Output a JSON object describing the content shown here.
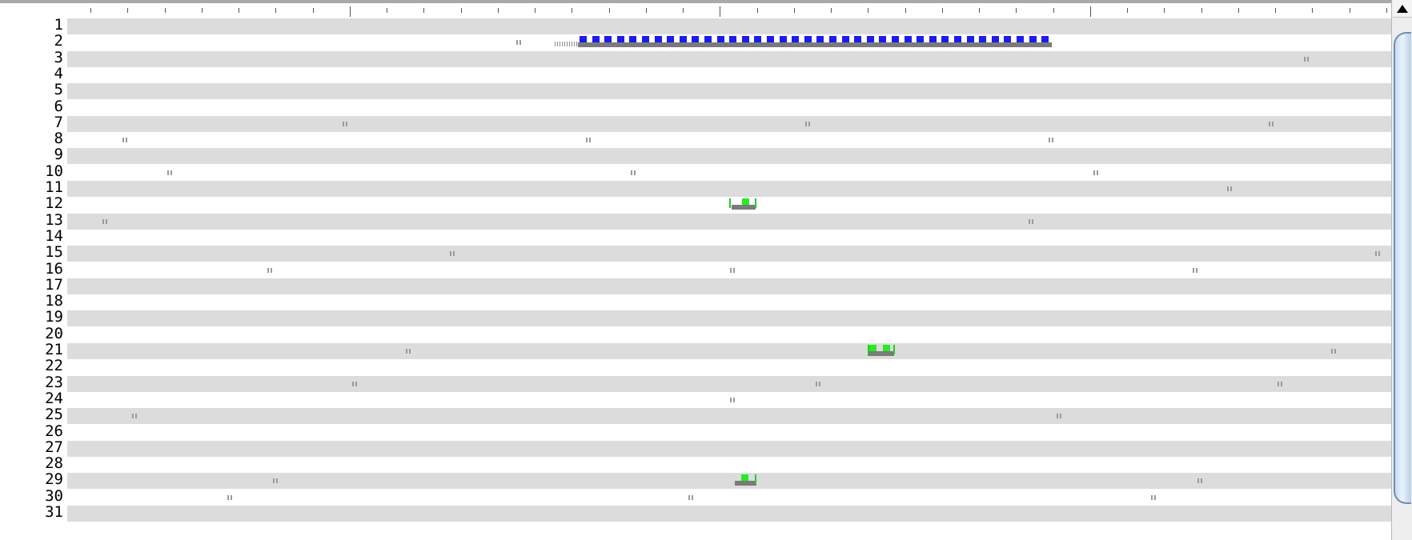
{
  "ruler": {
    "minor_tick_count": 36,
    "major_tick_every": 10
  },
  "track_rows": [
    {
      "label": "1"
    },
    {
      "label": "2"
    },
    {
      "label": "3"
    },
    {
      "label": "4"
    },
    {
      "label": "5"
    },
    {
      "label": "6"
    },
    {
      "label": "7"
    },
    {
      "label": "8"
    },
    {
      "label": "9"
    },
    {
      "label": "10"
    },
    {
      "label": "11"
    },
    {
      "label": "12"
    },
    {
      "label": "13"
    },
    {
      "label": "14"
    },
    {
      "label": "15"
    },
    {
      "label": "16"
    },
    {
      "label": "17"
    },
    {
      "label": "18"
    },
    {
      "label": "19"
    },
    {
      "label": "20"
    },
    {
      "label": "21"
    },
    {
      "label": "22"
    },
    {
      "label": "23"
    },
    {
      "label": "24"
    },
    {
      "label": "25"
    },
    {
      "label": "26"
    },
    {
      "label": "27"
    },
    {
      "label": "28"
    },
    {
      "label": "29"
    },
    {
      "label": "30"
    },
    {
      "label": "31"
    }
  ],
  "colors": {
    "band_shaded": "#dcdcdc",
    "band_plain": "#ffffff",
    "site_mark": "#9a9a9a",
    "cluster_bar": "#7a7a7a",
    "feature_blue": "#1a1aff",
    "feature_green": "#22ee22",
    "scroll_thumb": "#c9dcef"
  },
  "scrollbar": {
    "up_arrow_icon": "triangle-up-icon"
  }
}
